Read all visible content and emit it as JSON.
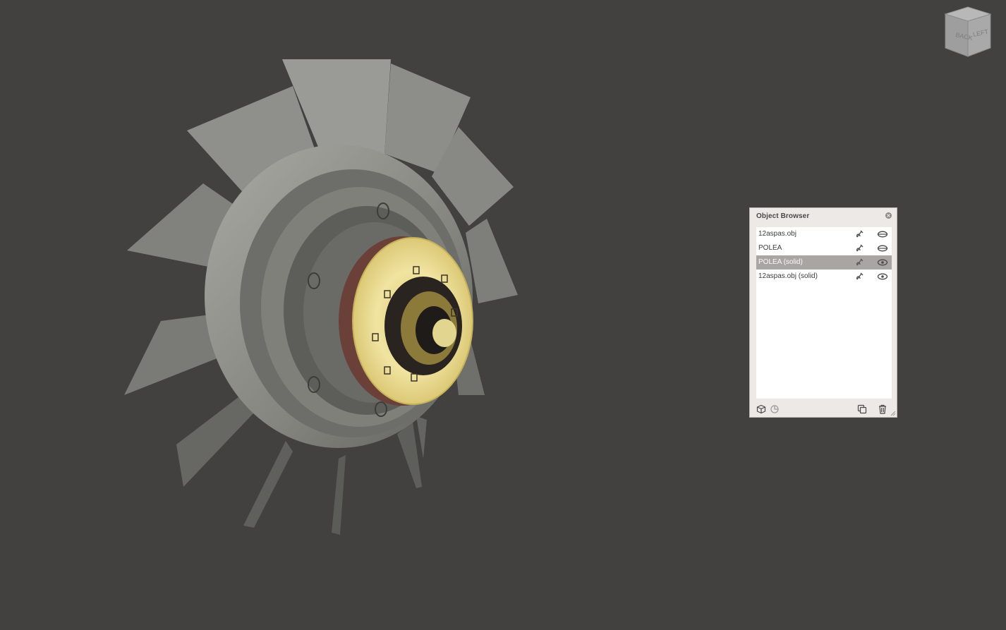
{
  "navcube": {
    "faces": [
      "BACK",
      "LEFT"
    ]
  },
  "object_browser": {
    "title": "Object Browser",
    "items": [
      {
        "name": "12aspas.obj",
        "selected": false,
        "visibility": "hidden"
      },
      {
        "name": "POLEA",
        "selected": false,
        "visibility": "hidden"
      },
      {
        "name": "POLEA (solid)",
        "selected": true,
        "visibility": "visible"
      },
      {
        "name": "12aspas.obj (solid)",
        "selected": false,
        "visibility": "visible"
      }
    ],
    "footer_icons": [
      "cube-icon",
      "pie-chart-icon",
      "copy-icon",
      "trash-icon"
    ]
  },
  "colors": {
    "background": "#434140",
    "panel": "#ece9e6",
    "selection": "#a8a5a2",
    "blade": "#8c8d88",
    "hub": "#9a9b95",
    "pulley": "#e8d98a"
  }
}
